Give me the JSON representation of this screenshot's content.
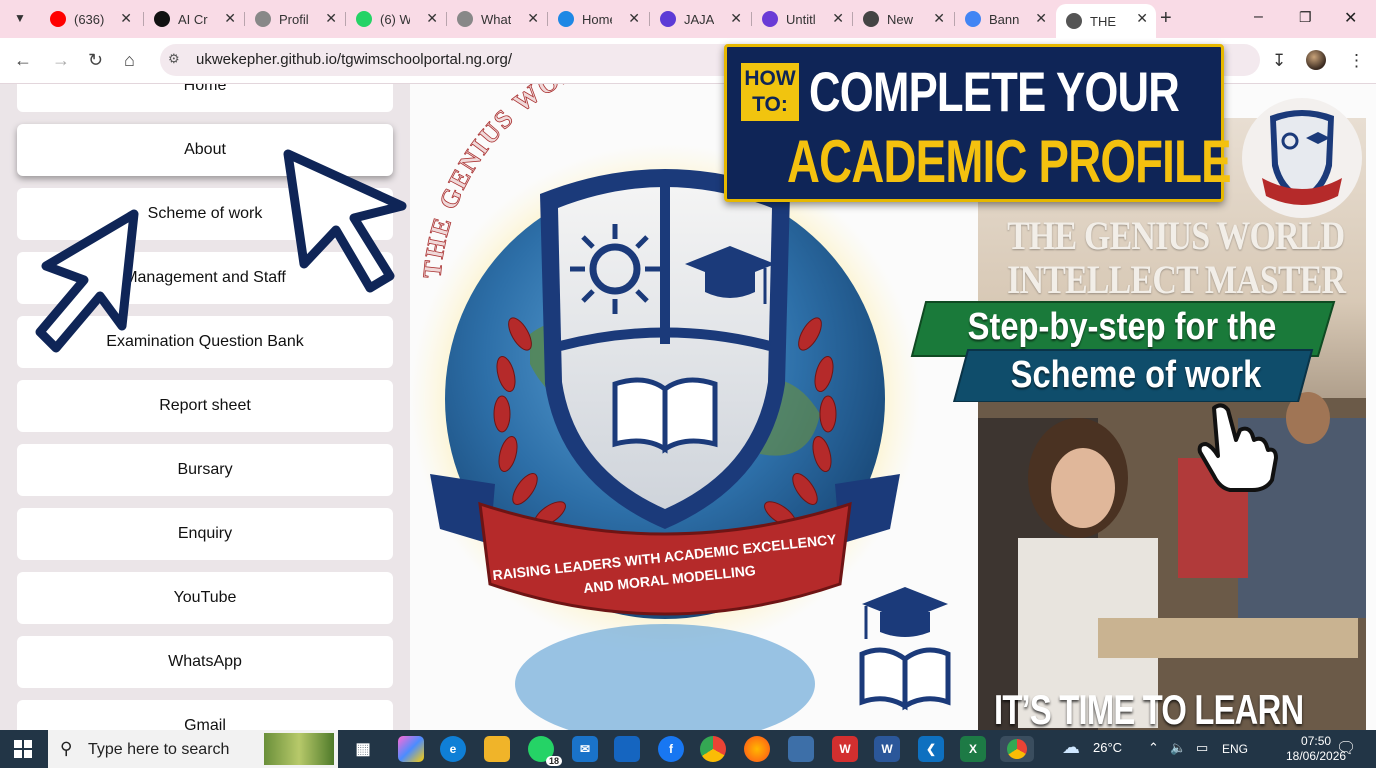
{
  "browser": {
    "tabs": [
      {
        "title": "(636)",
        "favicon": "youtube-icon",
        "color": "#ff0000"
      },
      {
        "title": "AI Cr",
        "favicon": "ai-icon",
        "color": "#111111"
      },
      {
        "title": "Profil",
        "favicon": "globe-icon",
        "color": "#888888"
      },
      {
        "title": "(6) W",
        "favicon": "whatsapp-icon",
        "color": "#25d366"
      },
      {
        "title": "What",
        "favicon": "globe-icon",
        "color": "#888888"
      },
      {
        "title": "Home",
        "favicon": "canva-icon",
        "color": "#1e88e5"
      },
      {
        "title": "JAJAI",
        "favicon": "shield-icon",
        "color": "#5c3bd6"
      },
      {
        "title": "Untitl",
        "favicon": "app-icon",
        "color": "#6a3bd6"
      },
      {
        "title": "New",
        "favicon": "chrome-icon",
        "color": "#444444"
      },
      {
        "title": "Bann",
        "favicon": "gemini-icon",
        "color": "#4285f4"
      },
      {
        "title": "THE C",
        "favicon": "globe-icon",
        "color": "#555555"
      }
    ],
    "url": "ukwekepher.github.io/tgwimschoolportal.ng.org/"
  },
  "sidebar": {
    "items": [
      {
        "label": "Home"
      },
      {
        "label": "About"
      },
      {
        "label": "Scheme of work"
      },
      {
        "label": "Management and Staff"
      },
      {
        "label": "Examination Question Bank"
      },
      {
        "label": "Report sheet"
      },
      {
        "label": "Bursary"
      },
      {
        "label": "Enquiry"
      },
      {
        "label": "YouTube"
      },
      {
        "label": "WhatsApp"
      },
      {
        "label": "Gmail"
      }
    ]
  },
  "hero": {
    "arc_text": "THE GENIUS WORLD INTELLECT MASTERS",
    "ribbon_line1": "RAISING LEADERS WITH ACADEMIC EXCELLENCY",
    "ribbon_line2": "AND MORAL MODELLING"
  },
  "banner": {
    "howto": "HOW TO:",
    "line1": "COMPLETE YOUR",
    "line2": "ACADEMIC PROFILE"
  },
  "photo": {
    "title1": "THE GENIUS WORLD",
    "title2": "INTELLECT MASTER",
    "step_line1": "Step-by-step for the",
    "step_line2": "Scheme of work",
    "footer": "IT’S TIME TO LEARN"
  },
  "taskbar": {
    "search_placeholder": "Type here to search",
    "whatsapp_badge": "18",
    "weather": "26°C",
    "language": "ENG",
    "time": "07:50",
    "date": "18/06/2026"
  }
}
